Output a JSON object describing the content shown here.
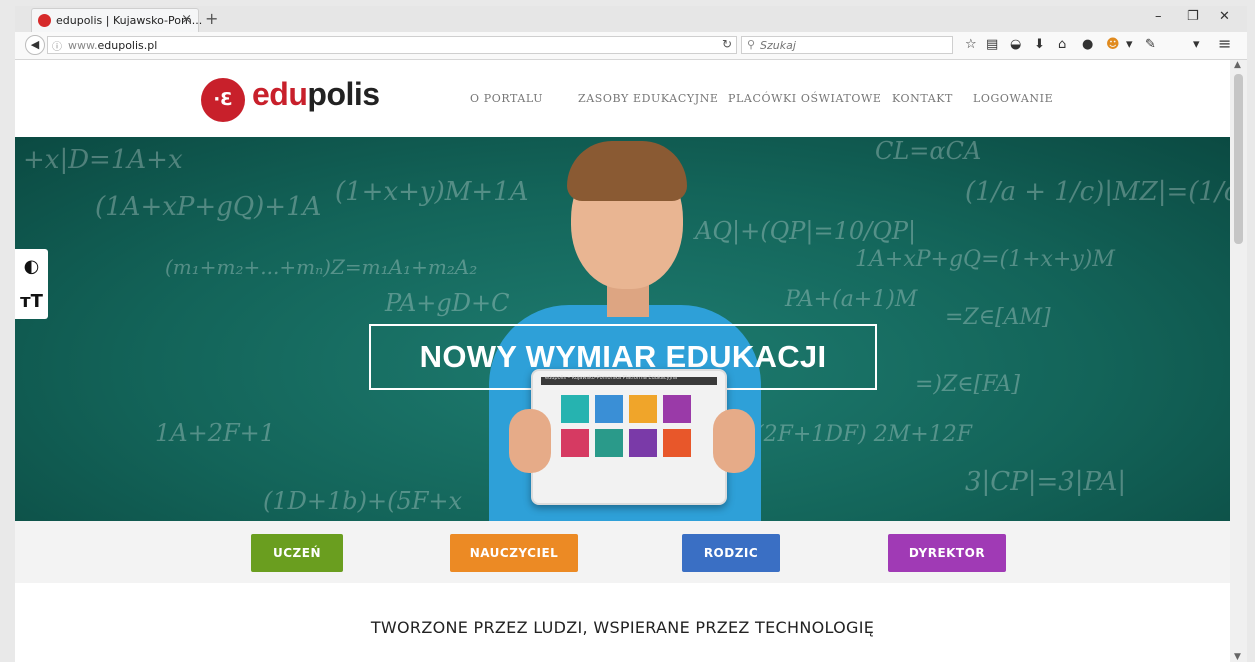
{
  "browser": {
    "tab_title": "edupolis | Kujawsko-Pom...",
    "new_tab": "+",
    "close_tab": "×",
    "url_prefix": "www.",
    "url_domain": "edupolis.pl",
    "search_placeholder": "Szukaj",
    "window_controls": [
      "–",
      "❐",
      "✕"
    ]
  },
  "logo": {
    "mark": "·Ɛ",
    "text_red": "edu",
    "text_dark": "polis"
  },
  "menu": [
    "O PORTALU",
    "ZASOBY EDUKACYJNE",
    "PLACÓWKI OŚWIATOWE",
    "KONTAKT",
    "LOGOWANIE"
  ],
  "hero": {
    "title": "NOWY WYMIAR EDUKACJI",
    "tablet_title": "edupolis – Kujawsko-Pomorska Platforma Edukacyjna"
  },
  "a11y": {
    "contrast": "◐",
    "fontsize": "ᴛT"
  },
  "roles": [
    {
      "label": "UCZEŃ",
      "color": "#6a9e1f"
    },
    {
      "label": "NAUCZYCIEL",
      "color": "#ec8a24"
    },
    {
      "label": "RODZIC",
      "color": "#3a6fc4"
    },
    {
      "label": "DYREKTOR",
      "color": "#a03ab5"
    }
  ],
  "tagline": "TWORZONE PRZEZ LUDZI, WSPIERANE PRZEZ TECHNOLOGIĘ",
  "colors": {
    "brand": "#c8202b"
  }
}
